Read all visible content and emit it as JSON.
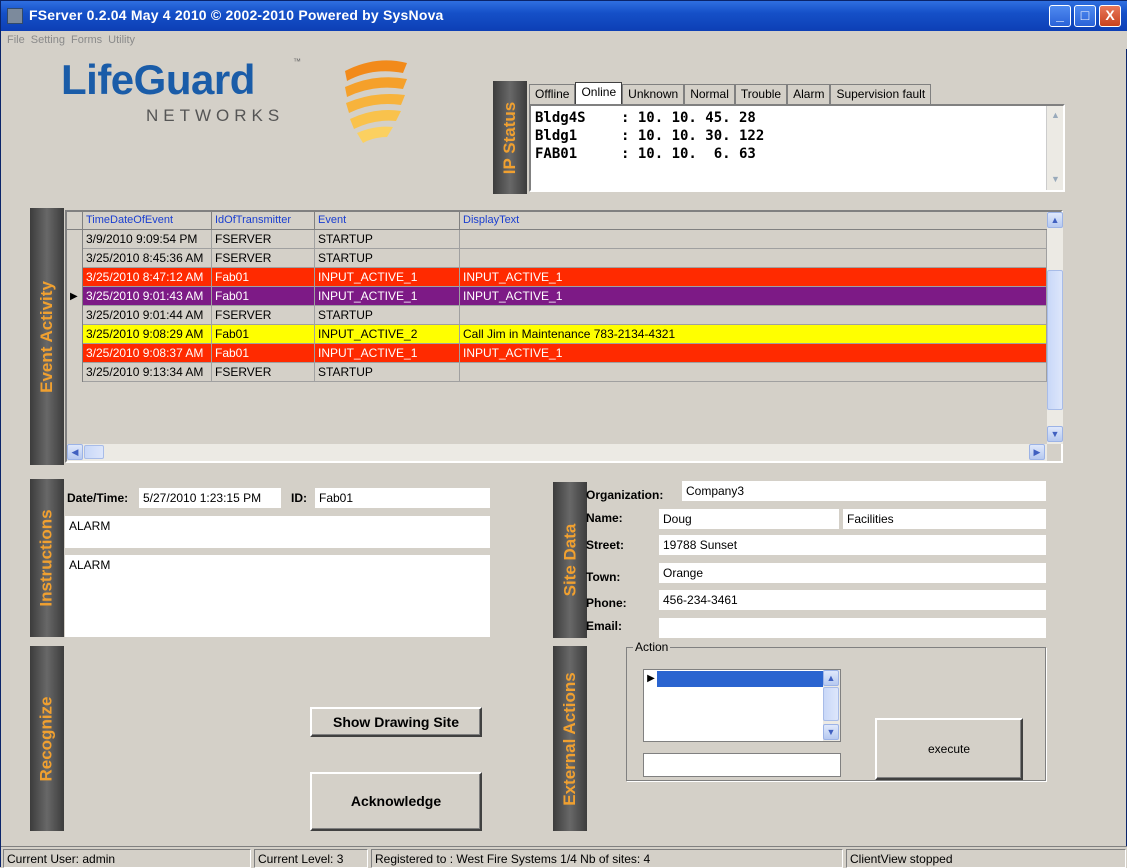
{
  "window": {
    "title": "FServer  0.2.04  May  4 2010 © 2002-2010 Powered by SysNova",
    "buttons": {
      "minimize": "_",
      "maximize": "□",
      "close": "X"
    }
  },
  "menu": [
    "File",
    "Setting",
    "Forms",
    "Utility"
  ],
  "logo": {
    "brand": "LifeGuard",
    "tm": "™",
    "sub": "NETWORKS"
  },
  "section_labels": {
    "ip_status": "IP Status",
    "event_activity": "Event Activity",
    "instructions": "Instructions",
    "site_data": "Site Data",
    "recognize": "Recognize",
    "external_actions": "External Actions"
  },
  "ip_status": {
    "tabs": [
      "Offline",
      "Online",
      "Unknown",
      "Normal",
      "Trouble",
      "Alarm",
      "Supervision fault"
    ],
    "active_tab": "Online",
    "entries": [
      {
        "name": "Bldg4S",
        "ip": ": 10. 10. 45. 28"
      },
      {
        "name": "Bldg1",
        "ip": ": 10. 10. 30. 122"
      },
      {
        "name": "FAB01",
        "ip": ": 10. 10.  6. 63"
      }
    ]
  },
  "events": {
    "columns": [
      "TimeDateOfEvent",
      "IdOfTransmitter",
      "Event",
      "DisplayText"
    ],
    "rows": [
      {
        "time": "3/9/2010 9:09:54 PM",
        "id": "FSERVER",
        "event": "STARTUP",
        "text": "",
        "color": "#d4d0c8",
        "fg": "#000000",
        "selected": false
      },
      {
        "time": "3/25/2010 8:45:36 AM",
        "id": "FSERVER",
        "event": "STARTUP",
        "text": "",
        "color": "#d4d0c8",
        "fg": "#000000",
        "selected": false
      },
      {
        "time": "3/25/2010 8:47:12 AM",
        "id": "Fab01",
        "event": "INPUT_ACTIVE_1",
        "text": "INPUT_ACTIVE_1",
        "color": "#ff2a00",
        "fg": "#ffffff",
        "selected": false
      },
      {
        "time": "3/25/2010 9:01:43 AM",
        "id": "Fab01",
        "event": "INPUT_ACTIVE_1",
        "text": "INPUT_ACTIVE_1",
        "color": "#7d1a86",
        "fg": "#ffffff",
        "selected": true
      },
      {
        "time": "3/25/2010 9:01:44 AM",
        "id": "FSERVER",
        "event": "STARTUP",
        "text": "",
        "color": "#d4d0c8",
        "fg": "#000000",
        "selected": false
      },
      {
        "time": "3/25/2010 9:08:29 AM",
        "id": "Fab01",
        "event": "INPUT_ACTIVE_2",
        "text": "Call Jim in Maintenance   783-2134-4321",
        "color": "#ffff00",
        "fg": "#000000",
        "selected": false
      },
      {
        "time": "3/25/2010 9:08:37 AM",
        "id": "Fab01",
        "event": "INPUT_ACTIVE_1",
        "text": "INPUT_ACTIVE_1",
        "color": "#ff2a00",
        "fg": "#ffffff",
        "selected": false
      },
      {
        "time": "3/25/2010 9:13:34 AM",
        "id": "FSERVER",
        "event": "STARTUP",
        "text": "",
        "color": "#d4d0c8",
        "fg": "#000000",
        "selected": false
      }
    ]
  },
  "instructions": {
    "datetime_label": "Date/Time:",
    "datetime_value": "5/27/2010 1:23:15 PM",
    "id_label": "ID:",
    "id_value": "Fab01",
    "line1": "ALARM",
    "line2": "ALARM"
  },
  "site_data": {
    "organization_label": "Organization:",
    "organization": "Company3",
    "name_label": "Name:",
    "name": "Doug",
    "department": "Facilities",
    "street_label": "Street:",
    "street": "19788 Sunset",
    "town_label": "Town:",
    "town": "Orange",
    "phone_label": "Phone:",
    "phone": "456-234-3461",
    "email_label": "Email:",
    "email": ""
  },
  "buttons": {
    "show_drawing": "Show Drawing Site",
    "acknowledge": "Acknowledge",
    "execute": "execute"
  },
  "external_actions": {
    "group_label": "Action",
    "command": ""
  },
  "status": {
    "user": "Current User: admin",
    "level": "Current Level: 3",
    "registered": "Registered to : West Fire Systems 1/4 Nb of sites: 4",
    "client": "ClientView stopped"
  }
}
